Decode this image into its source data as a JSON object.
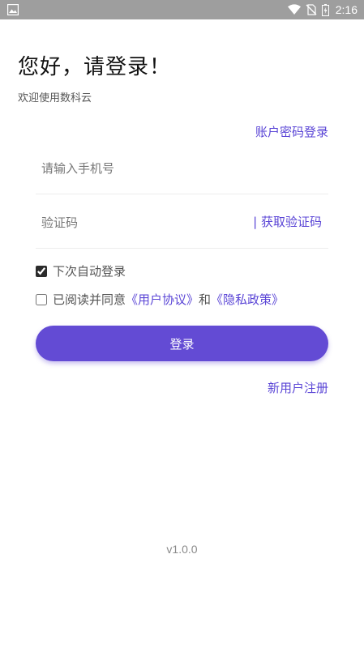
{
  "status_bar": {
    "time": "2:16",
    "icons": [
      "image-icon",
      "wifi-icon",
      "no-sim-icon",
      "battery-icon"
    ]
  },
  "header": {
    "greeting": "您好，请登录！",
    "welcome": "欢迎使用数科云"
  },
  "links": {
    "password_login": "账户密码登录",
    "register": "新用户注册"
  },
  "form": {
    "phone_placeholder": "请输入手机号",
    "code_placeholder": "验证码",
    "get_code": "| 获取验证码",
    "remember_label": "下次自动登录",
    "remember_checked": true,
    "agreement": {
      "checked": false,
      "prefix": "已阅读并同意",
      "user_agreement": "《用户协议》",
      "and": "和",
      "privacy_policy": "《隐私政策》"
    },
    "login_button": "登录"
  },
  "footer": {
    "version": "v1.0.0"
  },
  "colors": {
    "accent": "#634bd4",
    "link": "#5a45d6",
    "status_bar": "#9e9e9e"
  }
}
